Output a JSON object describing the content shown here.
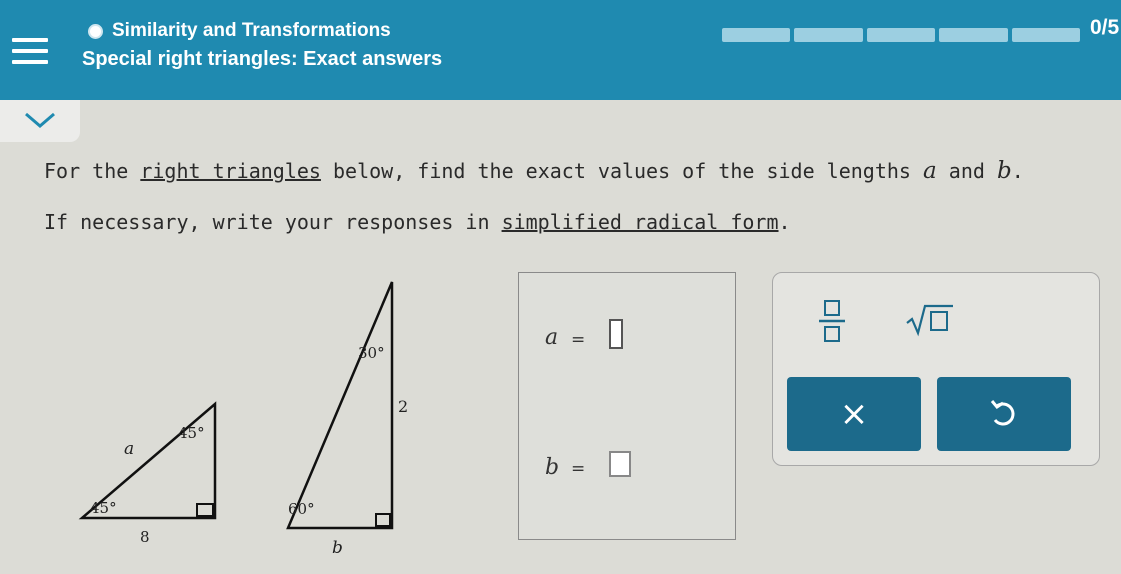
{
  "header": {
    "topic": "Similarity and Transformations",
    "lesson": "Special right triangles: Exact answers",
    "progress_label": "0/5",
    "progress_fraction": 0,
    "progress_segments": 5
  },
  "question": {
    "line1_pre": "For the ",
    "line1_link": "right triangles",
    "line1_mid": " below, find the exact values of the side lengths ",
    "var_a": "a",
    "line1_and": " and ",
    "var_b": "b",
    "line1_end": ".",
    "line2_pre": "If necessary, write your responses in ",
    "line2_link": "simplified radical form",
    "line2_end": "."
  },
  "triangle1": {
    "side_label": "a",
    "top_angle": "45°",
    "bottom_angle": "45°",
    "base": "8"
  },
  "triangle2": {
    "top_angle": "30°",
    "hypotenuse": "2",
    "bottom_angle": "60°",
    "base_label": "b"
  },
  "answers": {
    "a_label": "a",
    "b_label": "b",
    "equals": "="
  },
  "keypad": {
    "fraction_icon": "fraction-icon",
    "sqrt_icon": "sqrt-icon",
    "clear_symbol": "×",
    "undo_icon": "undo-icon"
  },
  "colors": {
    "header": "#1f8ab0",
    "button": "#1c6a8b",
    "background": "#dcdcd6"
  }
}
